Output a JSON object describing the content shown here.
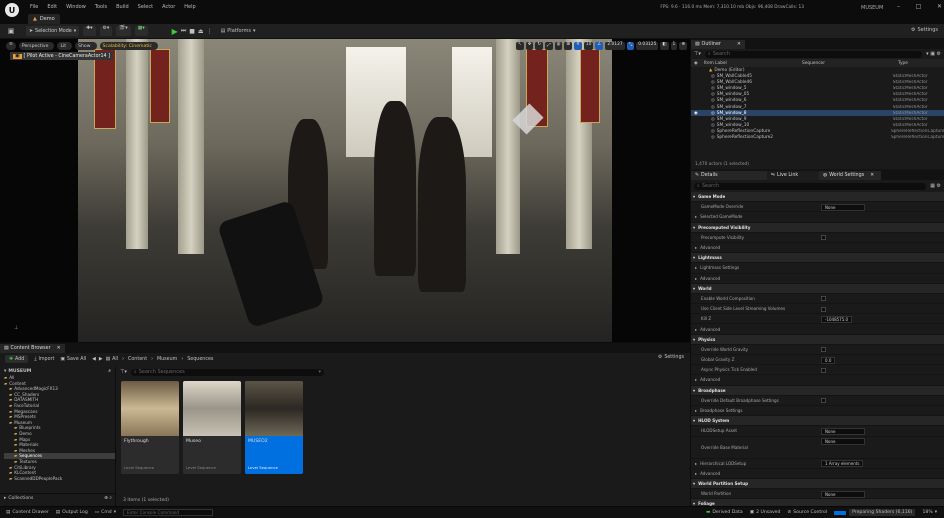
{
  "app": {
    "logo": "unreal-logo",
    "tab_name": "Demo",
    "menu": [
      "File",
      "Edit",
      "Window",
      "Tools",
      "Build",
      "Select",
      "Actor",
      "Help"
    ],
    "stats": "FPS: 9.6 · 116.0 ms  Mem: 7,310.10 mb  Objs: 96,408  DrawCalls: 13",
    "project": "MUSEUM",
    "window_buttons": [
      "–",
      "□",
      "✕"
    ]
  },
  "toolbar": {
    "selection_mode": "Selection Mode",
    "platforms": "Platforms",
    "settings": "Settings"
  },
  "viewport": {
    "perspective": "Perspective",
    "lit": "Lit",
    "show": "Show",
    "scalability": "Scalability: Cinematic",
    "pilot": "[ Pilot Active - CineCameraActor14 ]",
    "snap_value": "10",
    "angle_value": "2.0127",
    "scale_value": "0.03125",
    "cam_speed": "1"
  },
  "outliner": {
    "tab": "Outliner",
    "search_placeholder": "Search",
    "col_label": "Item Label",
    "col_sequencer": "Sequencer",
    "col_type": "Type",
    "root": "Demo (Editor)",
    "rows": [
      {
        "label": "SM_WallCable45",
        "type": "StaticMeshActor"
      },
      {
        "label": "SM_WallCable46",
        "type": "StaticMeshActor"
      },
      {
        "label": "SM_window_5",
        "type": "StaticMeshActor"
      },
      {
        "label": "SM_window_05",
        "type": "StaticMeshActor"
      },
      {
        "label": "SM_window_6",
        "type": "StaticMeshActor"
      },
      {
        "label": "SM_window_7",
        "type": "StaticMeshActor"
      },
      {
        "label": "SM_window_8",
        "type": "StaticMeshActor"
      },
      {
        "label": "SM_window_9",
        "type": "StaticMeshActor"
      },
      {
        "label": "SM_window_10",
        "type": "StaticMeshActor"
      },
      {
        "label": "SphereReflectionCapture",
        "type": "SphereReflectionCapture"
      },
      {
        "label": "SphereReflectionCapture2",
        "type": "SphereReflectionCapture"
      }
    ],
    "selected_index": 6,
    "footer": "1,470 actors (1 selected)"
  },
  "details": {
    "tab_details": "Details",
    "tab_livelink": "Live Link",
    "tab_world": "World Settings",
    "search_placeholder": "Search",
    "rows": [
      {
        "k": "sec",
        "t": "Game Mode"
      },
      {
        "k": "prop",
        "t": "GameMode Override",
        "v": "None"
      },
      {
        "k": "cat",
        "t": "Selected GameMode"
      },
      {
        "k": "sec",
        "t": "Precomputed Visibility"
      },
      {
        "k": "prop",
        "t": "Precompute Visibility",
        "c": true
      },
      {
        "k": "cat",
        "t": "Advanced"
      },
      {
        "k": "sec",
        "t": "Lightmass"
      },
      {
        "k": "cat",
        "t": "Lightmass Settings"
      },
      {
        "k": "cat",
        "t": "Advanced"
      },
      {
        "k": "sec",
        "t": "World"
      },
      {
        "k": "prop",
        "t": "Enable World Composition",
        "c": true
      },
      {
        "k": "prop",
        "t": "Use Client Side Level Streaming Volumes",
        "c": true
      },
      {
        "k": "prop",
        "t": "Kill Z",
        "v": "-1048575.0"
      },
      {
        "k": "cat",
        "t": "Advanced"
      },
      {
        "k": "sec",
        "t": "Physics"
      },
      {
        "k": "prop",
        "t": "Override World Gravity",
        "c": true
      },
      {
        "k": "prop",
        "t": "Global Gravity Z",
        "v": "0.0"
      },
      {
        "k": "prop",
        "t": "Async Physics Tick Enabled",
        "c": true
      },
      {
        "k": "cat",
        "t": "Advanced"
      },
      {
        "k": "sec",
        "t": "Broadphase"
      },
      {
        "k": "prop",
        "t": "Override Default Broadphase Settings",
        "c": true
      },
      {
        "k": "cat",
        "t": "Broadphase Settings"
      },
      {
        "k": "sec",
        "t": "HLOD System"
      },
      {
        "k": "prop",
        "t": "HLODSetup Asset",
        "v": "None"
      },
      {
        "k": "prop",
        "t": "Override Base Material",
        "v": "None",
        "tall": true
      },
      {
        "k": "cat",
        "t": "Hierarchical LODSetup",
        "v": "1 Array elements"
      },
      {
        "k": "cat",
        "t": "Advanced"
      },
      {
        "k": "sec",
        "t": "World Partition Setup"
      },
      {
        "k": "prop",
        "t": "World Partition",
        "v": "None"
      },
      {
        "k": "sec",
        "t": "Foliage"
      }
    ]
  },
  "content_browser": {
    "tab": "Content Browser",
    "add": "Add",
    "import": "Import",
    "save_all": "Save All",
    "path": [
      "All",
      "Content",
      "Museum",
      "Sequences"
    ],
    "settings": "Settings",
    "search_placeholder": "Search Sequences",
    "project_root": "MUSEUM",
    "tree": [
      "All",
      "Content",
      "AdvancedMagicFX13",
      "CC_Shaders",
      "DATASMITH",
      "FaceTutorial",
      "Megascans",
      "MSPresets",
      "Museum",
      "Blueprints",
      "Demo",
      "Maps",
      "Materials",
      "Meshes",
      "Sequences",
      "Textures",
      "CitiLibrary",
      "KLContent",
      "ScannedDDPeoplePack"
    ],
    "tree_selected": 14,
    "collections": "Collections",
    "assets": [
      {
        "name": "Flythrough",
        "type": "Level Sequence"
      },
      {
        "name": "Museo",
        "type": "Level Sequence"
      },
      {
        "name": "MUSEO2",
        "type": "Level Sequence"
      }
    ],
    "selected_asset": 2,
    "footer": "3 items (1 selected)"
  },
  "statusbar": {
    "content_drawer": "Content Drawer",
    "output_log": "Output Log",
    "cmd": "Cmd",
    "console_placeholder": "Enter Console Command",
    "derived_data": "Derived Data",
    "unsaved": "2 Unsaved",
    "source_control": "Source Control",
    "shaders": "Preparing Shaders (6,116)",
    "zoom": "18%"
  },
  "colors": {
    "accent": "#0070e0",
    "selected_row": "#2a4468",
    "play": "#3ec73e"
  }
}
